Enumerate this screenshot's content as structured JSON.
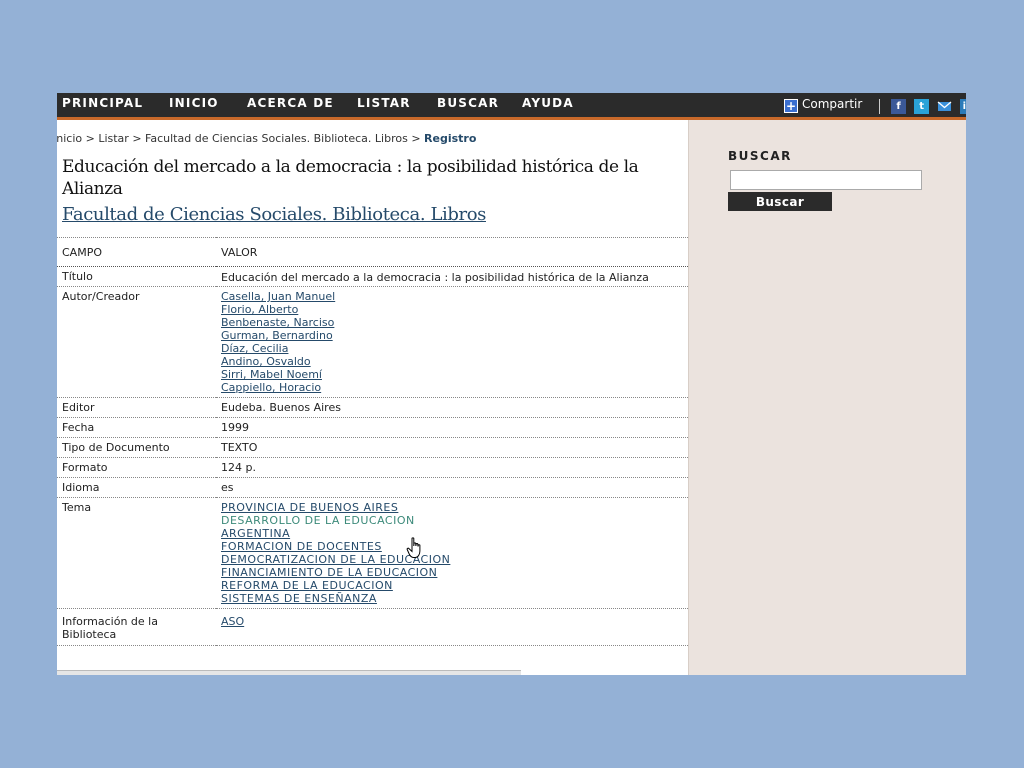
{
  "nav": {
    "items": [
      {
        "label": "PRINCIPAL"
      },
      {
        "label": "INICIO"
      },
      {
        "label": "ACERCA DE"
      },
      {
        "label": "LISTAR"
      },
      {
        "label": "BUSCAR"
      },
      {
        "label": "AYUDA"
      }
    ],
    "share_label": "Compartir",
    "social_icons": [
      "facebook-icon",
      "twitter-icon",
      "email-icon",
      "linkedin-icon"
    ],
    "accent_color": "#c8692a"
  },
  "breadcrumb": {
    "items": [
      "Inicio",
      "Listar",
      "Facultad de Ciencias Sociales. Biblioteca. Libros"
    ],
    "separator": ">",
    "current": "Registro"
  },
  "record": {
    "title": "Educación del mercado a la democracia : la posibilidad histórica de la Alianza",
    "collection": "Facultad de Ciencias Sociales. Biblioteca. Libros"
  },
  "table": {
    "headers": {
      "field": "CAMPO",
      "value": "VALOR"
    },
    "rows": {
      "titulo": {
        "label": "Título",
        "value": "Educación del mercado a la democracia : la posibilidad histórica de la Alianza"
      },
      "autor": {
        "label": "Autor/Creador",
        "values": [
          "Casella, Juan Manuel",
          "Florio, Alberto",
          "Benbenaste, Narciso",
          "Gurman, Bernardino",
          "Díaz, Cecilia",
          "Andino, Osvaldo",
          "Sirri, Mabel Noemí",
          "Cappiello, Horacio"
        ]
      },
      "editor": {
        "label": "Editor",
        "value": "Eudeba. Buenos Aires"
      },
      "fecha": {
        "label": "Fecha",
        "value": "1999"
      },
      "tipo": {
        "label": "Tipo de Documento",
        "value": "TEXTO"
      },
      "formato": {
        "label": "Formato",
        "value": "124 p."
      },
      "idioma": {
        "label": "Idioma",
        "value": "es"
      },
      "tema": {
        "label": "Tema",
        "values": [
          "PROVINCIA DE BUENOS AIRES",
          "DESARROLLO DE LA EDUCACION",
          "ARGENTINA",
          "FORMACION DE DOCENTES",
          "DEMOCRATIZACION DE LA EDUCACION",
          "FINANCIAMIENTO DE LA EDUCACION",
          "REFORMA DE LA EDUCACION",
          "SISTEMAS DE ENSEÑANZA"
        ]
      },
      "info": {
        "label": "Información de la Biblioteca",
        "value": "ASO"
      }
    }
  },
  "sidebar": {
    "title": "BUSCAR",
    "search_value": "",
    "button_label": "Buscar"
  }
}
